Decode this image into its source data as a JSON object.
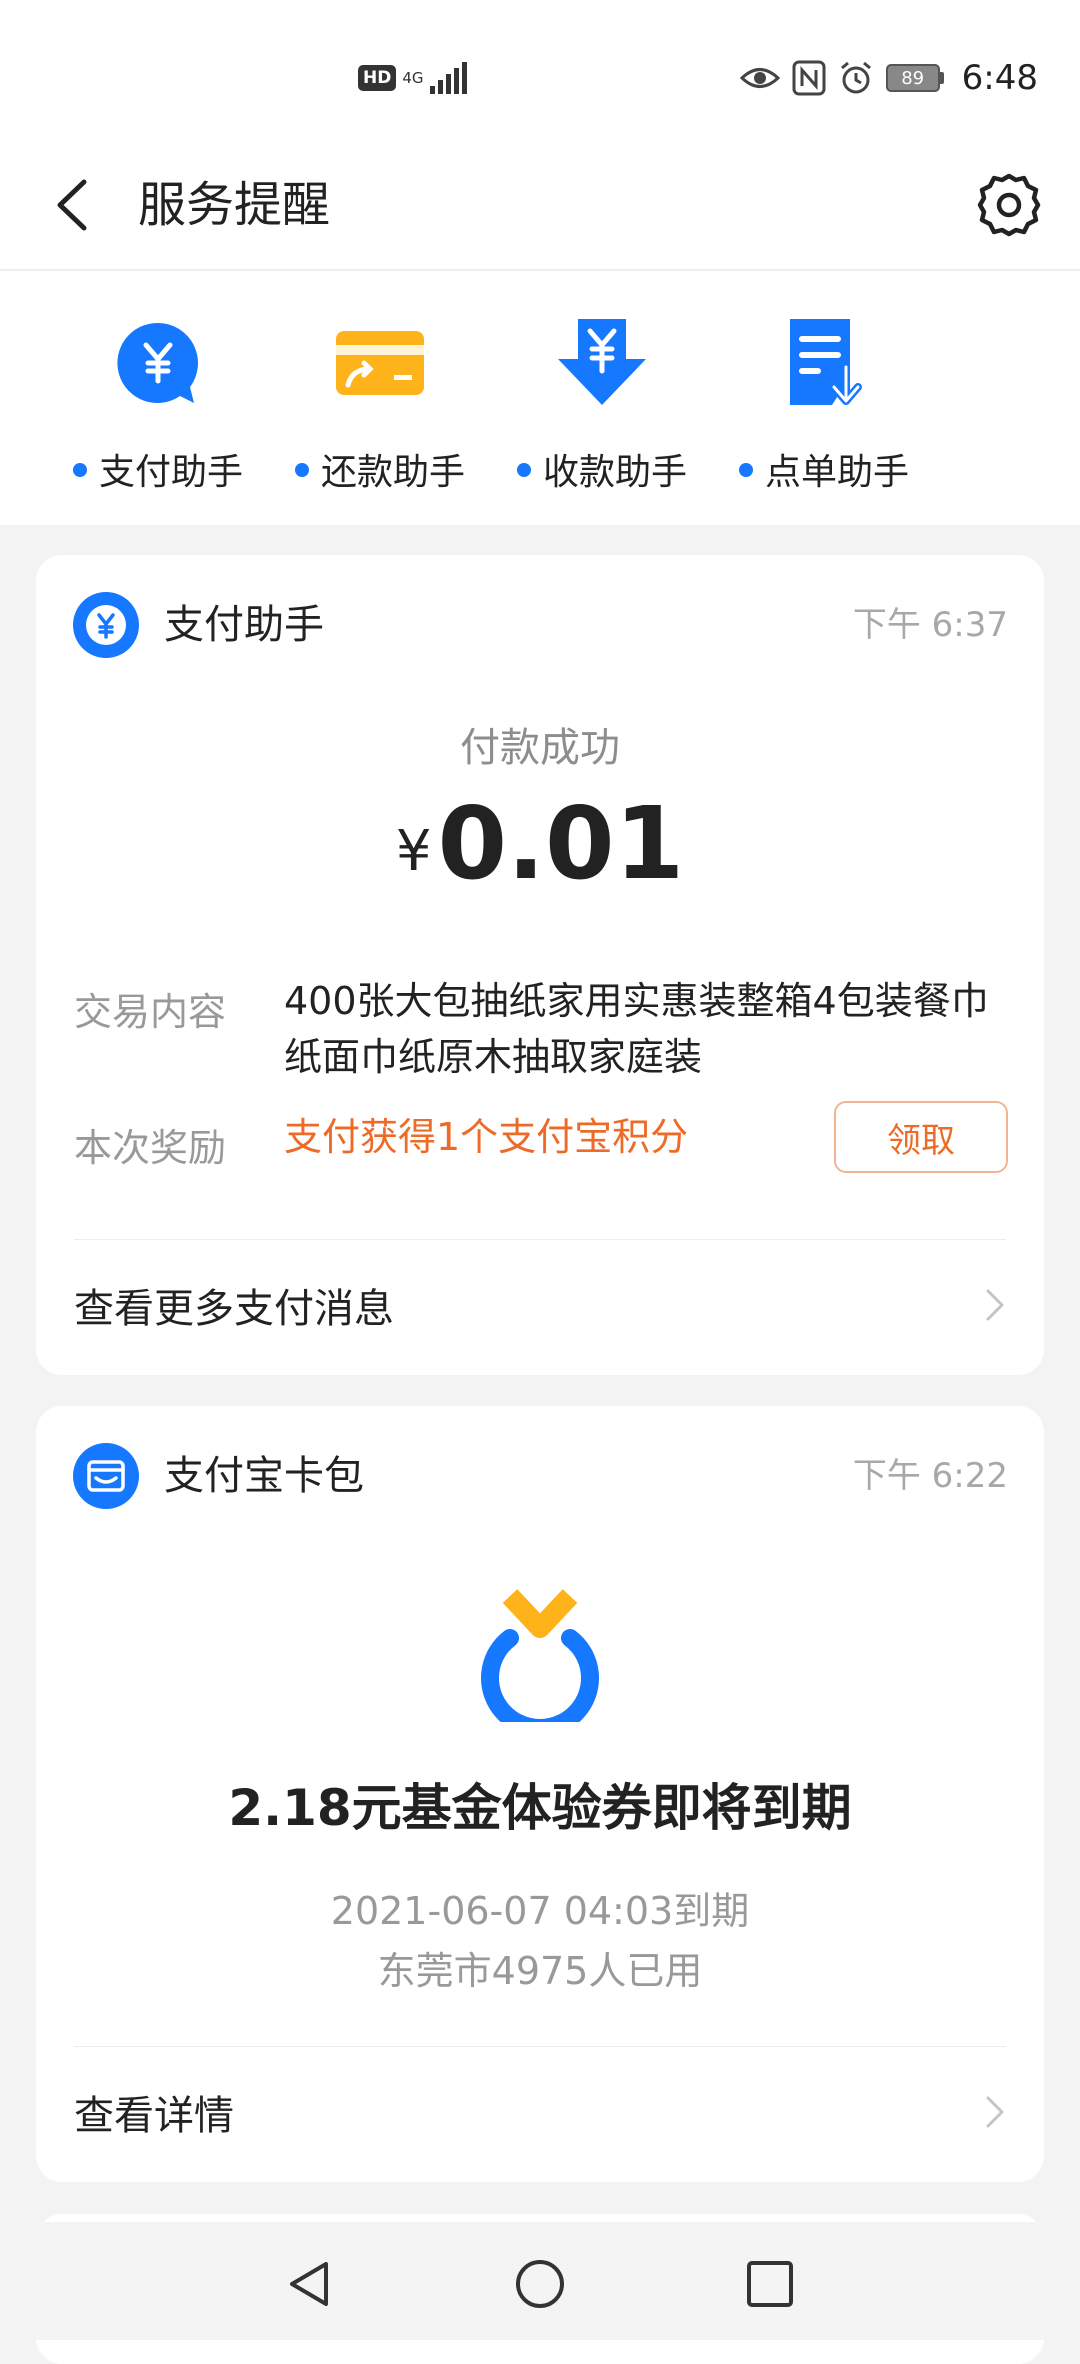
{
  "status_bar": {
    "hd": "HD",
    "network": "4G",
    "battery": "89",
    "time": "6:48"
  },
  "header": {
    "title": "服务提醒"
  },
  "quick_actions": [
    {
      "label": "支付助手",
      "icon": "yuan-chat-icon"
    },
    {
      "label": "还款助手",
      "icon": "card-repay-icon"
    },
    {
      "label": "收款助手",
      "icon": "yuan-download-icon"
    },
    {
      "label": "点单助手",
      "icon": "order-list-icon"
    }
  ],
  "payment_card": {
    "title": "支付助手",
    "time": "下午 6:37",
    "status": "付款成功",
    "currency": "¥",
    "amount": "0.01",
    "content_label": "交易内容",
    "content_value": "400张大包抽纸家用实惠装整箱4包装餐巾纸面巾纸原木抽取家庭装",
    "reward_label": "本次奖励",
    "reward_value": "支付获得1个支付宝积分",
    "claim_label": "领取",
    "more_label": "查看更多支付消息"
  },
  "wallet_card": {
    "title": "支付宝卡包",
    "time": "下午 6:22",
    "coupon_title": "2.18元基金体验券即将到期",
    "expiry": "2021-06-07 04:03到期",
    "usage": "东莞市4975人已用",
    "detail_label": "查看详情"
  },
  "colors": {
    "accent_blue": "#1677ff",
    "reward_orange": "#ee6b27",
    "repay_yellow": "#ffb31a"
  }
}
